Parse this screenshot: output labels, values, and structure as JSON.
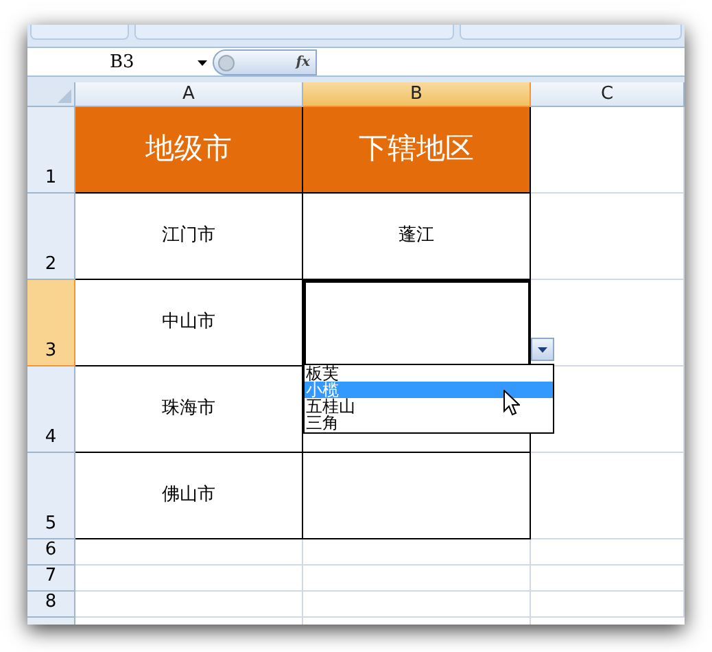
{
  "name_box": {
    "value": "B3"
  },
  "formula_bar": {
    "fx": "fx"
  },
  "columns": [
    {
      "label": "A",
      "selected": false
    },
    {
      "label": "B",
      "selected": true
    },
    {
      "label": "C",
      "selected": false
    }
  ],
  "rows": [
    {
      "label": "1",
      "selected": false,
      "kind": "header",
      "a": "地级市",
      "b": "下辖地区"
    },
    {
      "label": "2",
      "selected": false,
      "kind": "data",
      "a": "江门市",
      "b": "蓬江"
    },
    {
      "label": "3",
      "selected": true,
      "kind": "data",
      "a": "中山市"
    },
    {
      "label": "4",
      "selected": false,
      "kind": "data",
      "a": "珠海市"
    },
    {
      "label": "5",
      "selected": false,
      "kind": "data",
      "a": "佛山市"
    },
    {
      "label": "6",
      "selected": false,
      "kind": "blank"
    },
    {
      "label": "7",
      "selected": false,
      "kind": "blank"
    },
    {
      "label": "8",
      "selected": false,
      "kind": "blank"
    }
  ],
  "dropdown": {
    "items": [
      {
        "label": "板芙",
        "selected": false
      },
      {
        "label": "小榄",
        "selected": true
      },
      {
        "label": "五桂山",
        "selected": false
      },
      {
        "label": "三角",
        "selected": false
      }
    ]
  }
}
